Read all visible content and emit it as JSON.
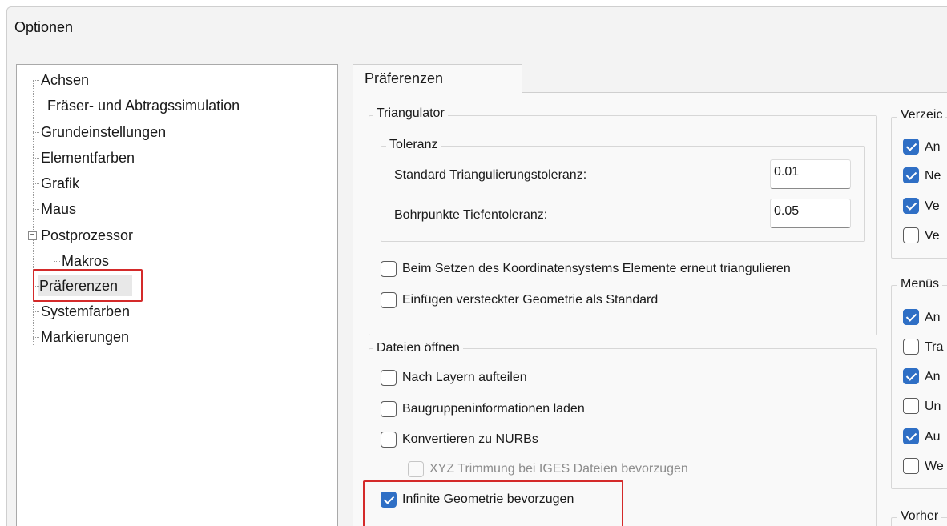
{
  "window": {
    "title": "Optionen"
  },
  "tree": {
    "items": [
      {
        "label": "Achsen"
      },
      {
        "label": "Fräser- und Abtragssimulation"
      },
      {
        "label": "Grundeinstellungen"
      },
      {
        "label": "Elementfarben"
      },
      {
        "label": "Grafik"
      },
      {
        "label": "Maus"
      },
      {
        "label": "Postprozessor"
      },
      {
        "label": "Makros"
      },
      {
        "label": "Präferenzen"
      },
      {
        "label": "Systemfarben"
      },
      {
        "label": "Markierungen"
      }
    ],
    "selected": "Präferenzen",
    "expander_symbol": "−"
  },
  "tab": {
    "label": "Präferenzen"
  },
  "triangulator": {
    "title": "Triangulator",
    "toleranz": {
      "title": "Toleranz",
      "standard_label": "Standard Triangulierungstoleranz:",
      "standard_value": "0.01",
      "bohr_label": "Bohrpunkte Tiefentoleranz:",
      "bohr_value": "0.05"
    },
    "cb_koordinaten": {
      "label": "Beim Setzen des Koordinatensystems Elemente erneut triangulieren",
      "checked": false
    },
    "cb_versteckt": {
      "label": "Einfügen versteckter Geometrie als Standard",
      "checked": false
    }
  },
  "dateien": {
    "title": "Dateien öffnen",
    "cb_layern": {
      "label": "Nach Layern aufteilen",
      "checked": false
    },
    "cb_baugruppen": {
      "label": "Baugruppeninformationen laden",
      "checked": false
    },
    "cb_nurbs": {
      "label": "Konvertieren zu NURBs",
      "checked": false
    },
    "cb_xyz": {
      "label": "XYZ Trimmung bei IGES Dateien bevorzugen",
      "checked": false,
      "disabled": true
    },
    "cb_infinite": {
      "label": "Infinite Geometrie bevorzugen",
      "checked": true
    }
  },
  "right": {
    "verzeichnis": {
      "title": "Verzeic",
      "items": [
        {
          "label": "An",
          "checked": true
        },
        {
          "label": "Ne",
          "checked": true
        },
        {
          "label": "Ve",
          "checked": true
        },
        {
          "label": "Ve",
          "checked": false
        }
      ]
    },
    "menues": {
      "title": "Menüs",
      "items": [
        {
          "label": "An",
          "checked": true
        },
        {
          "label": "Tra",
          "checked": false
        },
        {
          "label": "An",
          "checked": true
        },
        {
          "label": "Un",
          "checked": false
        },
        {
          "label": "Au",
          "checked": true
        },
        {
          "label": "We",
          "checked": false
        }
      ]
    },
    "vorher": {
      "title": "Vorher"
    }
  },
  "colors": {
    "accent": "#2f6fc5",
    "highlight_box": "#d42a2a"
  }
}
